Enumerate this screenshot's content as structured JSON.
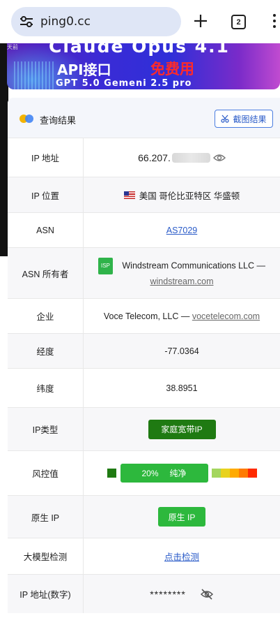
{
  "browser": {
    "url": "ping0.cc",
    "tab_count": "2"
  },
  "banner": {
    "headline": "Claude Opus 4.1",
    "api_text": "API接口",
    "free_text": "免费用",
    "models_text": "GPT 5.0   Gemeni 2.5 pro",
    "corner_text": "天前"
  },
  "card": {
    "title": "查询结果",
    "screenshot_button": "截图结果"
  },
  "rows": {
    "ip_address": {
      "label": "IP 地址",
      "value_prefix": "66.207."
    },
    "ip_location": {
      "label": "IP 位置",
      "value": "美国 哥伦比亚特区 华盛顿"
    },
    "asn": {
      "label": "ASN",
      "value": "AS7029"
    },
    "asn_owner": {
      "label": "ASN 所有者",
      "badge": "ISP",
      "name": "Windstream Communications LLC —",
      "domain": "windstream.com"
    },
    "enterprise": {
      "label": "企业",
      "name": "Voce Telecom, LLC —",
      "domain": "vocetelecom.com"
    },
    "longitude": {
      "label": "经度",
      "value": "-77.0364"
    },
    "latitude": {
      "label": "纬度",
      "value": "38.8951"
    },
    "ip_type": {
      "label": "IP类型",
      "value": "家庭宽带IP"
    },
    "risk": {
      "label": "风控值",
      "percent": "20%",
      "status": "纯净"
    },
    "native_ip": {
      "label": "原生 IP",
      "value": "原生 IP"
    },
    "llm_check": {
      "label": "大模型检测",
      "value": "点击检测"
    },
    "ip_numeric": {
      "label": "IP 地址(数字)",
      "value": "********"
    }
  },
  "colors": {
    "risk_scale": [
      "#a4d65e",
      "#e8d21d",
      "#ffaa00",
      "#ff7b00",
      "#ff2a00"
    ]
  }
}
